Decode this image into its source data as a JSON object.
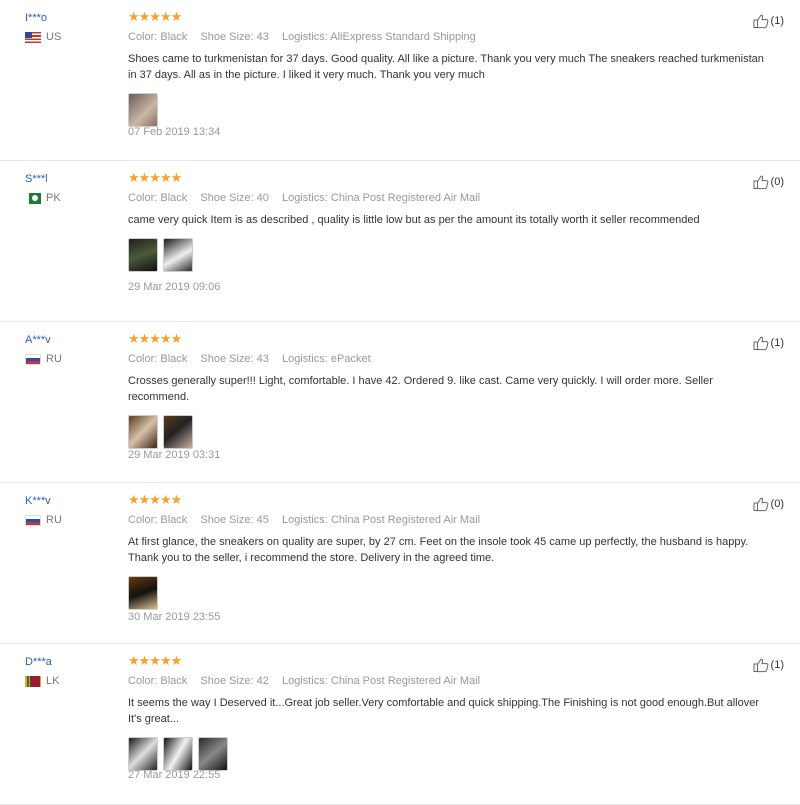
{
  "labels": {
    "color": "Color:",
    "shoe_size": "Shoe Size:",
    "logistics": "Logistics:"
  },
  "reviews": [
    {
      "user": "I***o",
      "country": "US",
      "flag": "us",
      "stars": "★★★★★",
      "color": "Black",
      "shoe_size": "43",
      "logistics": "AliExpress Standard Shipping",
      "text": "Shoes came to turkmenistan for 37 days. Good quality. All like a picture. Thank you very much The sneakers reached turkmenistan in 37 days. All as in the picture. I liked it very much. Thank you very much",
      "date": "07 Feb 2019 13:34",
      "helpful": "(1)",
      "photos": 1
    },
    {
      "user": "S***l",
      "country": "PK",
      "flag": "pk",
      "stars": "★★★★★",
      "color": "Black",
      "shoe_size": "40",
      "logistics": "China Post Registered Air Mail",
      "text": "came very quick Item is as described , quality is little low but as per the amount its totally worth it seller recommended",
      "date": "29 Mar 2019 09:06",
      "helpful": "(0)",
      "photos": 2
    },
    {
      "user": "A***v",
      "country": "RU",
      "flag": "ru",
      "stars": "★★★★★",
      "color": "Black",
      "shoe_size": "43",
      "logistics": "ePacket",
      "text": "Crosses generally super!!! Light, comfortable. I have 42. Ordered 9. like cast. Came very quickly. I will order more. Seller recommend.",
      "date": "29 Mar 2019 03:31",
      "helpful": "(1)",
      "photos": 2
    },
    {
      "user": "K***v",
      "country": "RU",
      "flag": "ru",
      "stars": "★★★★★",
      "color": "Black",
      "shoe_size": "45",
      "logistics": "China Post Registered Air Mail",
      "text": "At first glance, the sneakers on quality are super, by 27 cm. Feet on the insole took 45 came up perfectly, the husband is happy. Thank you to the seller, i recommend the store. Delivery in the agreed time.",
      "date": "30 Mar 2019 23:55",
      "helpful": "(0)",
      "photos": 1
    },
    {
      "user": "D***a",
      "country": "LK",
      "flag": "lk",
      "stars": "★★★★★",
      "color": "Black",
      "shoe_size": "42",
      "logistics": "China Post Registered Air Mail",
      "text": "It seems the way I Deserved it...Great job seller.Very comfortable and quick shipping.The Finishing is not good enough.But allover It's great...",
      "date": "27 Mar 2019 22:55",
      "helpful": "(1)",
      "photos": 3
    }
  ]
}
